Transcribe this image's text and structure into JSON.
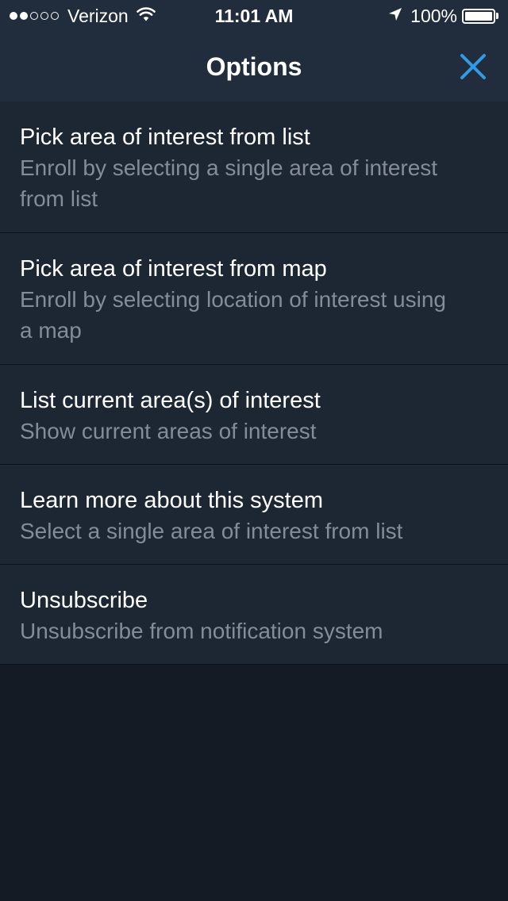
{
  "status_bar": {
    "signal_bars_filled": 2,
    "signal_bars_total": 5,
    "carrier": "Verizon",
    "time": "11:01 AM",
    "battery_percent": "100%",
    "battery_level": 1.0,
    "icons": [
      "wifi-icon",
      "location-arrow-icon",
      "battery-icon"
    ]
  },
  "header": {
    "title": "Options",
    "close_icon": "close-icon",
    "accent_color": "#2f9be6"
  },
  "options": [
    {
      "title": "Pick area of interest from list",
      "subtitle": "Enroll by selecting a single area of interest from list"
    },
    {
      "title": "Pick area of interest from map",
      "subtitle": "Enroll by selecting location of interest using a map"
    },
    {
      "title": "List current area(s) of interest",
      "subtitle": "Show current areas of interest"
    },
    {
      "title": "Learn more about this system",
      "subtitle": "Select a single area of interest from list"
    },
    {
      "title": "Unsubscribe",
      "subtitle": "Unsubscribe from notification system"
    }
  ],
  "colors": {
    "header_bg": "#212d3c",
    "row_bg": "#1d2734",
    "page_bg": "#151b24",
    "subtitle_text": "#848c98",
    "separator": "#0c1118"
  }
}
